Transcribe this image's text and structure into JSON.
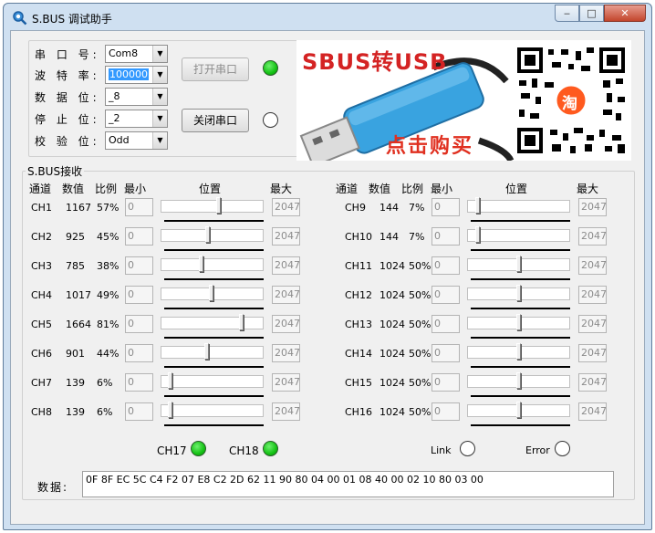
{
  "window": {
    "title": "S.BUS 调试助手",
    "controls": {
      "minimize": "‒",
      "maximize": "□",
      "close": "✕"
    }
  },
  "serial": {
    "rows": [
      {
        "label": "串 口 号:",
        "value": "Com8",
        "selected": false
      },
      {
        "label": "波 特 率:",
        "value": "100000",
        "selected": true
      },
      {
        "label": "数 据 位:",
        "value": "_8",
        "selected": false
      },
      {
        "label": "停 止 位:",
        "value": "_2",
        "selected": false
      },
      {
        "label": "校 验 位:",
        "value": "Odd",
        "selected": false
      }
    ],
    "open_button": "打开串口",
    "close_button": "关闭串口",
    "open_led": "on",
    "close_led": "off"
  },
  "banner": {
    "text_top": "SBUS转USB",
    "text_bottom": "点击购买",
    "badge": "淘"
  },
  "receive": {
    "group_title": "S.BUS接收",
    "headers": {
      "channel": "通道",
      "value": "数值",
      "ratio": "比例",
      "min": "最小",
      "position": "位置",
      "max": "最大"
    },
    "channels": [
      {
        "name": "CH1",
        "value": "1167",
        "ratio": "57%",
        "min": "0",
        "max": "2047",
        "level": 0.57
      },
      {
        "name": "CH2",
        "value": "925",
        "ratio": "45%",
        "min": "0",
        "max": "2047",
        "level": 0.45
      },
      {
        "name": "CH3",
        "value": "785",
        "ratio": "38%",
        "min": "0",
        "max": "2047",
        "level": 0.38
      },
      {
        "name": "CH4",
        "value": "1017",
        "ratio": "49%",
        "min": "0",
        "max": "2047",
        "level": 0.49
      },
      {
        "name": "CH5",
        "value": "1664",
        "ratio": "81%",
        "min": "0",
        "max": "2047",
        "level": 0.81
      },
      {
        "name": "CH6",
        "value": "901",
        "ratio": "44%",
        "min": "0",
        "max": "2047",
        "level": 0.44
      },
      {
        "name": "CH7",
        "value": "139",
        "ratio": "6%",
        "min": "0",
        "max": "2047",
        "level": 0.06
      },
      {
        "name": "CH8",
        "value": "139",
        "ratio": "6%",
        "min": "0",
        "max": "2047",
        "level": 0.06
      },
      {
        "name": "CH9",
        "value": "144",
        "ratio": "7%",
        "min": "0",
        "max": "2047",
        "level": 0.07
      },
      {
        "name": "CH10",
        "value": "144",
        "ratio": "7%",
        "min": "0",
        "max": "2047",
        "level": 0.07
      },
      {
        "name": "CH11",
        "value": "1024",
        "ratio": "50%",
        "min": "0",
        "max": "2047",
        "level": 0.5
      },
      {
        "name": "CH12",
        "value": "1024",
        "ratio": "50%",
        "min": "0",
        "max": "2047",
        "level": 0.5
      },
      {
        "name": "CH13",
        "value": "1024",
        "ratio": "50%",
        "min": "0",
        "max": "2047",
        "level": 0.5
      },
      {
        "name": "CH14",
        "value": "1024",
        "ratio": "50%",
        "min": "0",
        "max": "2047",
        "level": 0.5
      },
      {
        "name": "CH15",
        "value": "1024",
        "ratio": "50%",
        "min": "0",
        "max": "2047",
        "level": 0.5
      },
      {
        "name": "CH16",
        "value": "1024",
        "ratio": "50%",
        "min": "0",
        "max": "2047",
        "level": 0.5
      }
    ],
    "status": {
      "ch17_label": "CH17",
      "ch17_led": "on",
      "ch18_label": "CH18",
      "ch18_led": "on",
      "link_label": "Link",
      "link_led": "off",
      "error_label": "Error",
      "error_led": "off"
    },
    "data_label": "数据:",
    "data_hex": "0F 8F EC 5C C4 F2 07 E8 C2 2D 62 11 90 80 04 00 01 08 40 00 02 10 80 03 00"
  }
}
